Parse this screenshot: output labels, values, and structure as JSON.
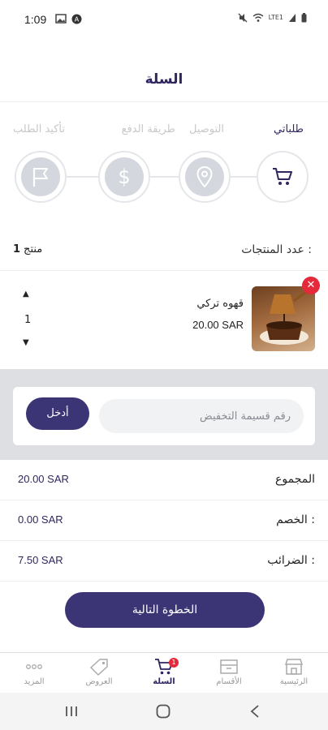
{
  "status_bar": {
    "time": "1:09",
    "signal_text": "LTE1"
  },
  "header": {
    "title": "السلة"
  },
  "steps": [
    {
      "label": "طلباتي",
      "icon": "cart-icon",
      "active": true
    },
    {
      "label": "التوصيل",
      "icon": "location-pin-icon",
      "active": false
    },
    {
      "label": "طريقة الدفع",
      "icon": "dollar-icon",
      "active": false
    },
    {
      "label": "تأكيد الطلب",
      "icon": "flag-icon",
      "active": false
    }
  ],
  "products_count": {
    "label": "عدد المنتجات :",
    "count": "1",
    "unit": "منتج"
  },
  "product": {
    "name": "قهوه تركي",
    "price": "20.00 SAR",
    "quantity": "1",
    "remove_symbol": "✕"
  },
  "coupon": {
    "placeholder": "رقم قسيمة التخفيض",
    "apply_label": "أدخل"
  },
  "summary": {
    "total_label": "المجموع",
    "total_value": "20.00 SAR",
    "discount_label": "الخصم :",
    "discount_value": "0.00 SAR",
    "tax_label": "الضرائب :",
    "tax_value": "7.50 SAR"
  },
  "next_button": {
    "label": "الخطوة التالية"
  },
  "bottom_nav": {
    "home": "الرئيسية",
    "categories": "الأقسام",
    "cart": "السلة",
    "cart_badge": "1",
    "offers": "العروض",
    "more": "المزيد"
  },
  "colors": {
    "primary": "#3c3575",
    "danger": "#e4293b",
    "muted": "#c8c8cc"
  }
}
